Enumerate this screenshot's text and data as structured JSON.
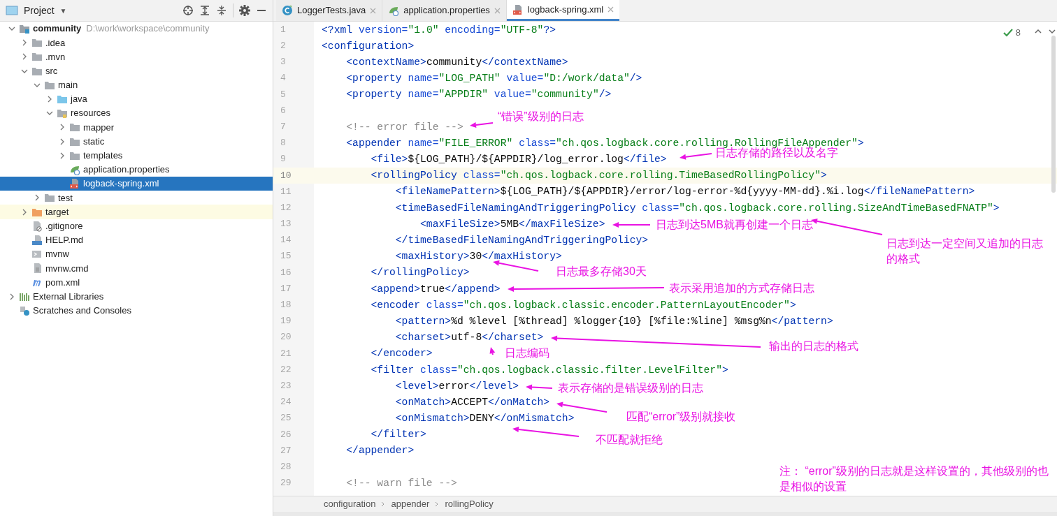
{
  "project_panel": {
    "title": "Project",
    "caret": "▼"
  },
  "tree": [
    {
      "name": "community",
      "path": "D:\\work\\workspace\\community",
      "kind": "module",
      "expanded": true,
      "selected": false,
      "children": [
        {
          "name": ".idea",
          "kind": "folder",
          "expanded": false,
          "selected": false
        },
        {
          "name": ".mvn",
          "kind": "folder",
          "expanded": false,
          "selected": false
        },
        {
          "name": "src",
          "kind": "folder",
          "expanded": true,
          "selected": false,
          "children": [
            {
              "name": "main",
              "kind": "folder",
              "expanded": true,
              "selected": false,
              "children": [
                {
                  "name": "java",
                  "kind": "source",
                  "expanded": false,
                  "selected": false
                },
                {
                  "name": "resources",
                  "kind": "resources",
                  "expanded": true,
                  "selected": false,
                  "children": [
                    {
                      "name": "mapper",
                      "kind": "folder",
                      "expanded": false,
                      "selected": false
                    },
                    {
                      "name": "static",
                      "kind": "folder",
                      "expanded": false,
                      "selected": false
                    },
                    {
                      "name": "templates",
                      "kind": "folder",
                      "expanded": false,
                      "selected": false
                    },
                    {
                      "name": "application.properties",
                      "kind": "properties",
                      "selected": false
                    },
                    {
                      "name": "logback-spring.xml",
                      "kind": "xml",
                      "selected": true
                    }
                  ]
                }
              ]
            },
            {
              "name": "test",
              "kind": "folder",
              "expanded": false,
              "selected": false
            }
          ]
        },
        {
          "name": "target",
          "kind": "excluded",
          "expanded": false,
          "selected": false
        },
        {
          "name": ".gitignore",
          "kind": "ignore",
          "selected": false
        },
        {
          "name": "HELP.md",
          "kind": "markdown",
          "selected": false
        },
        {
          "name": "mvnw",
          "kind": "script",
          "selected": false
        },
        {
          "name": "mvnw.cmd",
          "kind": "file",
          "selected": false
        },
        {
          "name": "pom.xml",
          "kind": "maven",
          "selected": false
        }
      ]
    },
    {
      "name": "External Libraries",
      "kind": "libraries",
      "expanded": false,
      "selected": false
    },
    {
      "name": "Scratches and Consoles",
      "kind": "scratches",
      "selected": false
    }
  ],
  "tabs": [
    {
      "label": "LoggerTests.java",
      "kind": "java",
      "selected": false
    },
    {
      "label": "application.properties",
      "kind": "properties",
      "selected": false
    },
    {
      "label": "logback-spring.xml",
      "kind": "xml",
      "selected": true
    }
  ],
  "inspection": {
    "count": "8"
  },
  "code_lines": [
    {
      "number": "1",
      "text": "<?xml version=\"1.0\" encoding=\"UTF-8\"?>",
      "current": false
    },
    {
      "number": "2",
      "text": "<configuration>",
      "current": false
    },
    {
      "number": "3",
      "text": "    <contextName>community</contextName>",
      "current": false
    },
    {
      "number": "4",
      "text": "    <property name=\"LOG_PATH\" value=\"D:/work/data\"/>",
      "current": false
    },
    {
      "number": "5",
      "text": "    <property name=\"APPDIR\" value=\"community\"/>",
      "current": false
    },
    {
      "number": "6",
      "current": false
    },
    {
      "number": "7",
      "text": "    <!-- error file -->",
      "current": false
    },
    {
      "number": "8",
      "text": "    <appender name=\"FILE_ERROR\" class=\"ch.qos.logback.core.rolling.RollingFileAppender\">",
      "current": false
    },
    {
      "number": "9",
      "text": "        <file>${LOG_PATH}/${APPDIR}/log_error.log</file>",
      "current": false
    },
    {
      "number": "10",
      "text": "        <rollingPolicy class=\"ch.qos.logback.core.rolling.TimeBasedRollingPolicy\">",
      "current": true
    },
    {
      "number": "11",
      "text": "            <fileNamePattern>${LOG_PATH}/${APPDIR}/error/log-error-%d{yyyy-MM-dd}.%i.log</fileNamePattern>",
      "current": false
    },
    {
      "number": "12",
      "text": "            <timeBasedFileNamingAndTriggeringPolicy class=\"ch.qos.logback.core.rolling.SizeAndTimeBasedFNATP\">",
      "current": false
    },
    {
      "number": "13",
      "text": "                <maxFileSize>5MB</maxFileSize>",
      "current": false
    },
    {
      "number": "14",
      "text": "            </timeBasedFileNamingAndTriggeringPolicy>",
      "current": false
    },
    {
      "number": "15",
      "text": "            <maxHistory>30</maxHistory>",
      "current": false
    },
    {
      "number": "16",
      "text": "        </rollingPolicy>",
      "current": false
    },
    {
      "number": "17",
      "text": "        <append>true</append>",
      "current": false
    },
    {
      "number": "18",
      "text": "        <encoder class=\"ch.qos.logback.classic.encoder.PatternLayoutEncoder\">",
      "current": false
    },
    {
      "number": "19",
      "text": "            <pattern>%d %level [%thread] %logger{10} [%file:%line] %msg%n</pattern>",
      "current": false
    },
    {
      "number": "20",
      "text": "            <charset>utf-8</charset>",
      "current": false
    },
    {
      "number": "21",
      "text": "        </encoder>",
      "current": false
    },
    {
      "number": "22",
      "text": "        <filter class=\"ch.qos.logback.classic.filter.LevelFilter\">",
      "current": false
    },
    {
      "number": "23",
      "text": "            <level>error</level>",
      "current": false
    },
    {
      "number": "24",
      "text": "            <onMatch>ACCEPT</onMatch>",
      "current": false
    },
    {
      "number": "25",
      "text": "            <onMismatch>DENY</onMismatch>",
      "current": false
    },
    {
      "number": "26",
      "text": "        </filter>",
      "current": false
    },
    {
      "number": "27",
      "text": "    </appender>",
      "current": false
    },
    {
      "number": "28",
      "current": false
    },
    {
      "number": "29",
      "text": "    <!-- warn file -->",
      "current": false
    }
  ],
  "annotations": [
    "“错误”级别的日志",
    "日志存储的路径以及名字",
    "日志到达5MB就再创建一个日志",
    "日志到达一定空间又追加的日志的格式",
    "日志最多存储30天",
    "表示采用追加的方式存储日志",
    "输出的日志的格式",
    "日志编码",
    "表示存储的是错误级别的日志",
    "匹配“error”级别就接收",
    "不匹配就拒绝",
    "注： “error”级别的日志就是这样设置的，其他级别的也是相似的设置"
  ],
  "breadcrumbs": [
    "configuration",
    "appender",
    "rollingPolicy"
  ]
}
